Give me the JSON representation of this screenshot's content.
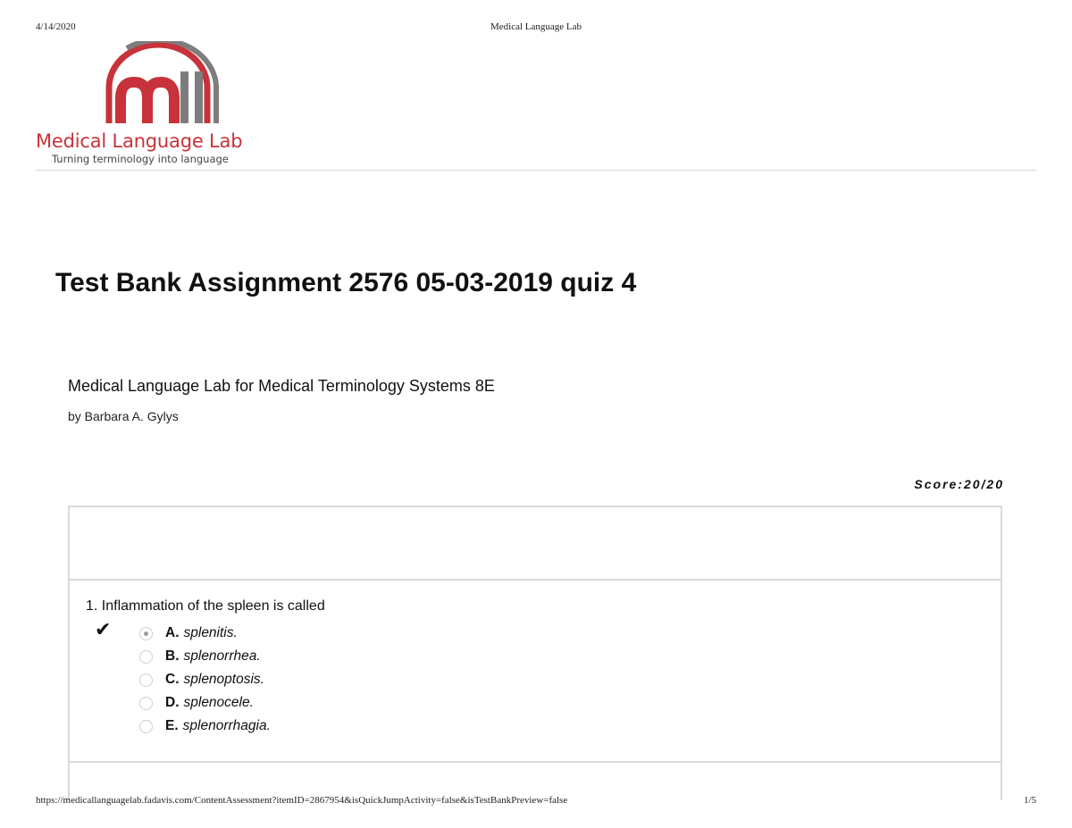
{
  "print_header": {
    "date": "4/14/2020",
    "site": "Medical Language Lab"
  },
  "logo": {
    "brand": "Medical Language Lab",
    "tagline": "Turning terminology into language"
  },
  "colors": {
    "brand_red": "#c8323a",
    "brand_gray": "#7d7d7d"
  },
  "page_title": "Test Bank Assignment 2576 05-03-2019 quiz 4",
  "book": {
    "title": "Medical Language Lab for Medical Terminology Systems 8E",
    "author": "by Barbara A. Gylys"
  },
  "score": "Score:20/20",
  "questions": [
    {
      "number": "1.",
      "text": "Inflammation of the spleen is called",
      "correct_icon": "check-mark-icon",
      "options": [
        {
          "letter": "A.",
          "text": "splenitis.",
          "selected": true
        },
        {
          "letter": "B.",
          "text": "splenorrhea.",
          "selected": false
        },
        {
          "letter": "C.",
          "text": "splenoptosis.",
          "selected": false
        },
        {
          "letter": "D.",
          "text": "splenocele.",
          "selected": false
        },
        {
          "letter": "E.",
          "text": "splenorrhagia.",
          "selected": false
        }
      ]
    }
  ],
  "print_footer": {
    "url": "https://medicallanguagelab.fadavis.com/ContentAssessment?itemID=2867954&isQuickJumpActivity=false&isTestBankPreview=false",
    "page": "1/5"
  }
}
